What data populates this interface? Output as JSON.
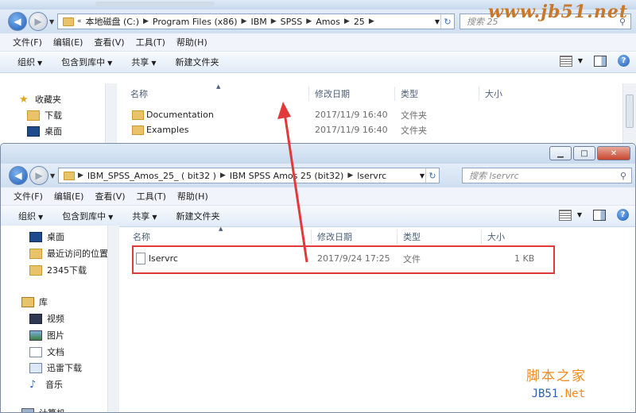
{
  "top_window": {
    "address": {
      "crumbs": [
        "本地磁盘 (C:)",
        "Program Files (x86)",
        "IBM",
        "SPSS",
        "Amos",
        "25"
      ]
    },
    "search_placeholder": "搜索 25",
    "menu": [
      "文件(F)",
      "编辑(E)",
      "查看(V)",
      "工具(T)",
      "帮助(H)"
    ],
    "commands": [
      "组织",
      "包含到库中",
      "共享",
      "新建文件夹"
    ],
    "nav": [
      "收藏夹",
      "下载",
      "桌面"
    ],
    "columns": [
      "名称",
      "修改日期",
      "类型",
      "大小"
    ],
    "rows": [
      {
        "name": "Documentation",
        "date": "2017/11/9 16:40",
        "type": "文件夹",
        "size": ""
      },
      {
        "name": "Examples",
        "date": "2017/11/9 16:40",
        "type": "文件夹",
        "size": ""
      }
    ]
  },
  "bottom_window": {
    "address": {
      "crumbs": [
        "IBM_SPSS_Amos_25_ ( bit32 )",
        "IBM SPSS Amos 25 (bit32)",
        "lservrc"
      ]
    },
    "search_placeholder": "搜索 lservrc",
    "menu": [
      "文件(F)",
      "编辑(E)",
      "查看(V)",
      "工具(T)",
      "帮助(H)"
    ],
    "commands": [
      "组织",
      "包含到库中",
      "共享",
      "新建文件夹"
    ],
    "nav": [
      "桌面",
      "最近访问的位置",
      "2345下载",
      "库",
      "视频",
      "图片",
      "文档",
      "迅雷下载",
      "音乐",
      "计算机"
    ],
    "columns": [
      "名称",
      "修改日期",
      "类型",
      "大小"
    ],
    "rows": [
      {
        "name": "lservrc",
        "date": "2017/9/24 17:25",
        "type": "文件",
        "size": "1 KB"
      }
    ]
  },
  "watermark": {
    "top": "www.jb51.net",
    "cn": "脚本之家",
    "jb": "JB51",
    "net": ".Net"
  },
  "colors": {
    "highlight_box": "#e23a3a",
    "arrow": "#e23a3a"
  }
}
